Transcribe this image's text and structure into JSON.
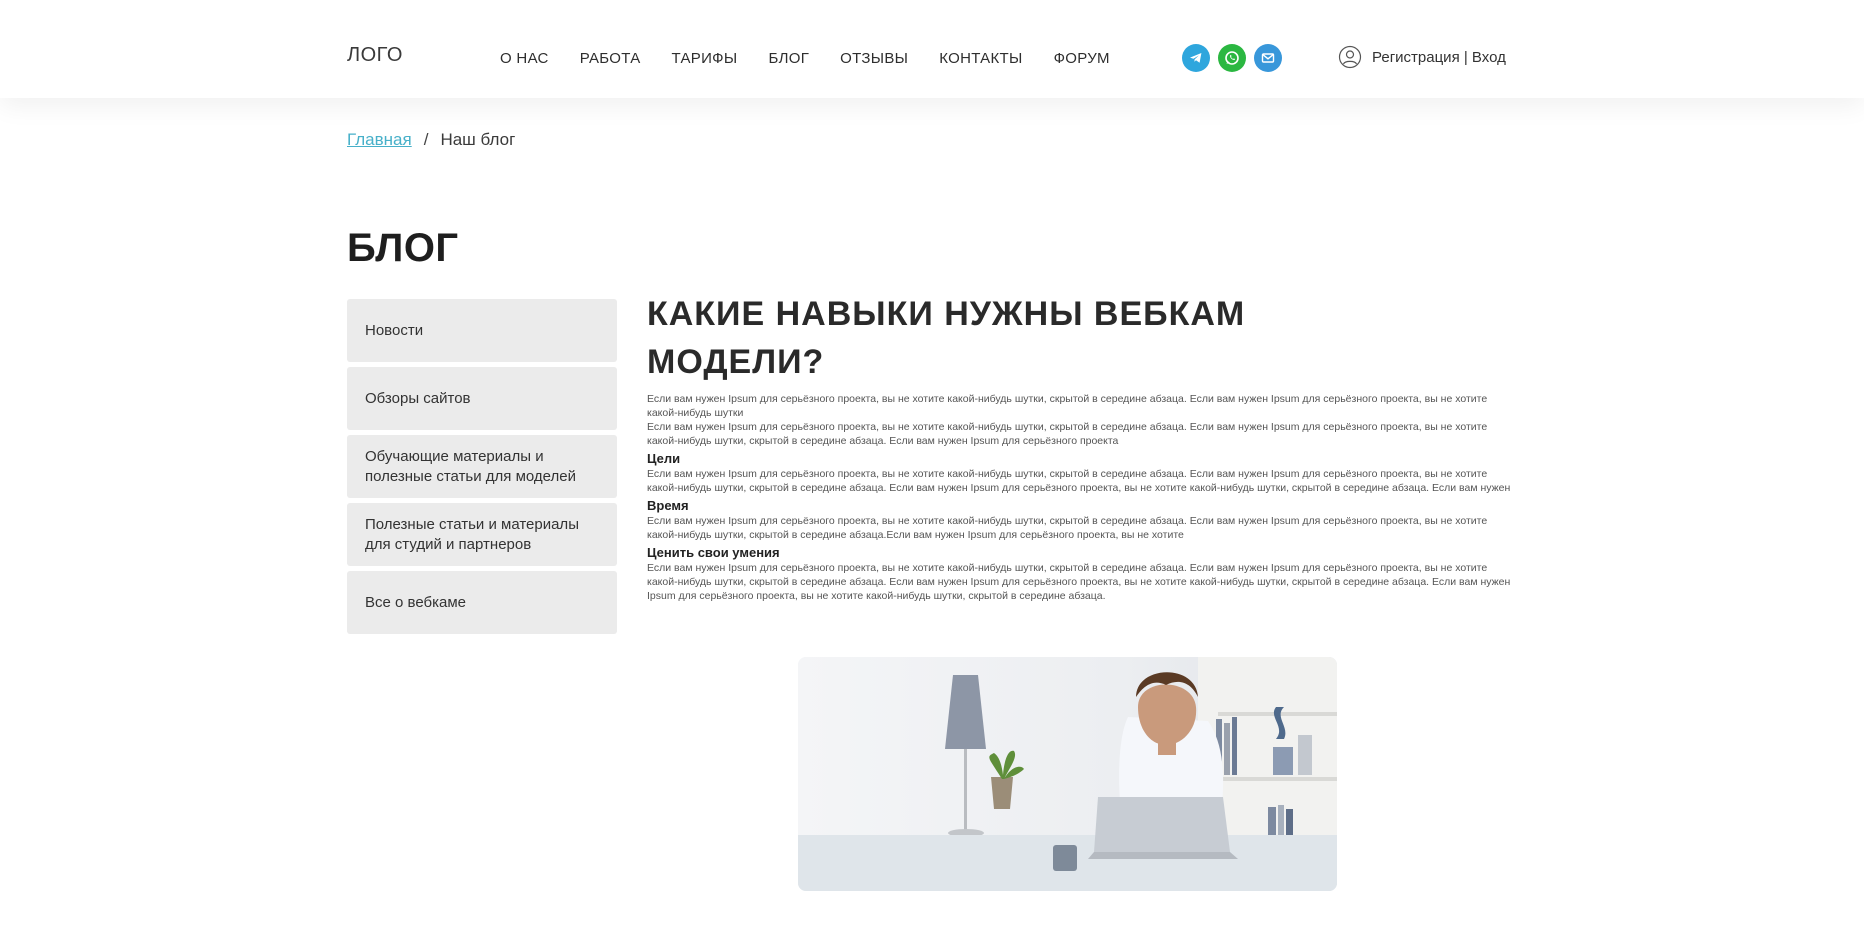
{
  "header": {
    "logo": "ЛОГО",
    "nav": [
      "О НАС",
      "РАБОТА",
      "ТАРИФЫ",
      "БЛОГ",
      "ОТЗЫВЫ",
      "КОНТАКТЫ",
      "ФОРУМ"
    ],
    "socials": [
      "telegram-icon",
      "whatsapp-icon",
      "mail-icon"
    ],
    "register": "Регистрация",
    "separator": " | ",
    "login": "Вход"
  },
  "breadcrumb": {
    "home": "Главная",
    "sep": "/",
    "current": "Наш блог"
  },
  "page_title": "БЛОГ",
  "sidebar": {
    "items": [
      "Новости",
      "Обзоры сайтов",
      "Обучающие материалы и полезные статьи для моделей",
      "Полезные статьи и материалы для студий и партнеров",
      "Все о вебкаме"
    ]
  },
  "article": {
    "title": "КАКИЕ НАВЫКИ НУЖНЫ ВЕБКАМ МОДЕЛИ?",
    "p1": "Если вам нужен Ipsum для серьёзного проекта, вы не хотите какой-нибудь шутки, скрытой в середине абзаца. Если вам нужен Ipsum для серьёзного проекта, вы не хотите какой-нибудь шутки",
    "p2": "Если вам нужен Ipsum для серьёзного проекта, вы не хотите какой-нибудь шутки, скрытой в середине абзаца. Если вам нужен Ipsum для серьёзного проекта, вы не хотите какой-нибудь шутки, скрытой в середине абзаца. Если вам нужен Ipsum для серьёзного проекта",
    "h1": "Цели",
    "p3": "Если вам нужен Ipsum для серьёзного проекта, вы не хотите какой-нибудь шутки, скрытой в середине абзаца. Если вам нужен Ipsum для серьёзного проекта, вы не хотите какой-нибудь шутки, скрытой в середине абзаца. Если вам нужен Ipsum для серьёзного проекта, вы не хотите какой-нибудь шутки, скрытой в середине абзаца. Если вам нужен",
    "h2": "Время",
    "p4": "Если вам нужен Ipsum для серьёзного проекта, вы не хотите какой-нибудь шутки, скрытой в середине абзаца. Если вам нужен Ipsum для серьёзного проекта, вы не хотите какой-нибудь шутки, скрытой в середине абзаца.Если вам нужен Ipsum для серьёзного проекта, вы не хотите",
    "h3": "Ценить свои умения",
    "p5": "Если вам нужен Ipsum для серьёзного проекта, вы не хотите какой-нибудь шутки, скрытой в середине абзаца. Если вам нужен Ipsum для серьёзного проекта, вы не хотите какой-нибудь шутки, скрытой в середине абзаца. Если вам нужен Ipsum для серьёзного проекта, вы не хотите какой-нибудь шутки, скрытой в середине абзаца. Если вам нужен Ipsum для серьёзного проекта, вы не хотите какой-нибудь шутки, скрытой в середине абзаца."
  },
  "colors": {
    "accent_link": "#47b0c9",
    "sidebar_bg": "#ebebeb",
    "telegram": "#2ea6dd",
    "whatsapp": "#2bb741",
    "mail": "#3897da"
  }
}
